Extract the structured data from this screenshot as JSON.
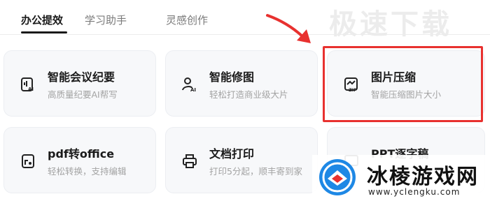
{
  "tabs": [
    {
      "label": "办公提效",
      "active": true
    },
    {
      "label": "学习助手",
      "active": false
    },
    {
      "label": "灵感创作",
      "active": false
    }
  ],
  "watermark_top": "极速下载",
  "cards": [
    {
      "title": "智能会议纪要",
      "subtitle": "高质量纪要AI帮写",
      "icon": "meeting-ai-icon"
    },
    {
      "title": "智能修图",
      "subtitle": "轻松打造商业级大片",
      "icon": "user-ai-icon"
    },
    {
      "title": "图片压缩",
      "subtitle": "智能压缩图片大小",
      "icon": "image-zip-icon"
    },
    {
      "title": "pdf转office",
      "subtitle": "轻松转换，支持编辑",
      "icon": "pdf-convert-icon"
    },
    {
      "title": "文档打印",
      "subtitle": "打印5分起，顺丰寄到家",
      "icon": "printer-icon"
    },
    {
      "title": "PPT逐字稿",
      "subtitle": "",
      "icon": "ppt-script-icon"
    }
  ],
  "logo": {
    "name": "冰棱游戏网",
    "url": "www.yclengku.com"
  },
  "colors": {
    "highlight": "#e8312f",
    "card_bg": "#f7f8fa",
    "logo_blue": "#1e88e5"
  }
}
